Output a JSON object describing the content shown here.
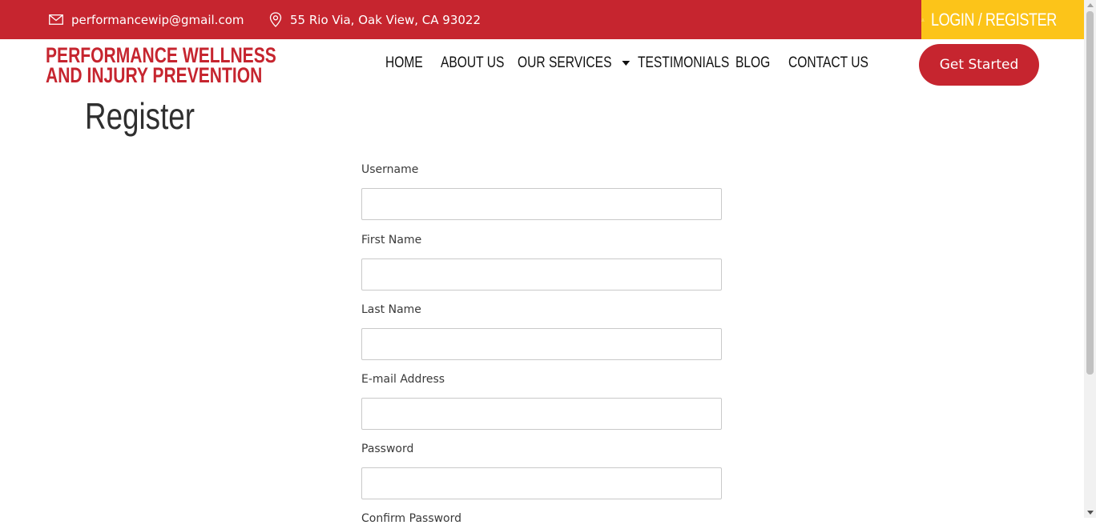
{
  "topbar": {
    "email": "performancewip@gmail.com",
    "address": "55 Rio Via, Oak View, CA 93022",
    "login_label": "LOGIN / REGISTER",
    "colors": {
      "bar": "#c6252f",
      "login_bg": "#fcc419"
    },
    "icons": {
      "email": "mail-icon",
      "address": "location-pin-icon",
      "login": "user-icon"
    }
  },
  "logo": {
    "line1": "PERFORMANCE WELLNESS",
    "line2": "AND INJURY PREVENTION"
  },
  "nav": {
    "items": [
      {
        "label": "HOME"
      },
      {
        "label": "ABOUT US"
      },
      {
        "label": "OUR SERVICES",
        "has_dropdown": true
      },
      {
        "label": "TESTIMONIALS"
      },
      {
        "label": "BLOG"
      },
      {
        "label": "CONTACT US"
      }
    ]
  },
  "cta": {
    "label": "Get Started"
  },
  "page": {
    "title": "Register"
  },
  "form": {
    "fields": [
      {
        "label": "Username",
        "value": ""
      },
      {
        "label": "First Name",
        "value": ""
      },
      {
        "label": "Last Name",
        "value": ""
      },
      {
        "label": "E-mail Address",
        "value": ""
      },
      {
        "label": "Password",
        "value": ""
      },
      {
        "label": "Confirm Password",
        "value": ""
      }
    ]
  }
}
